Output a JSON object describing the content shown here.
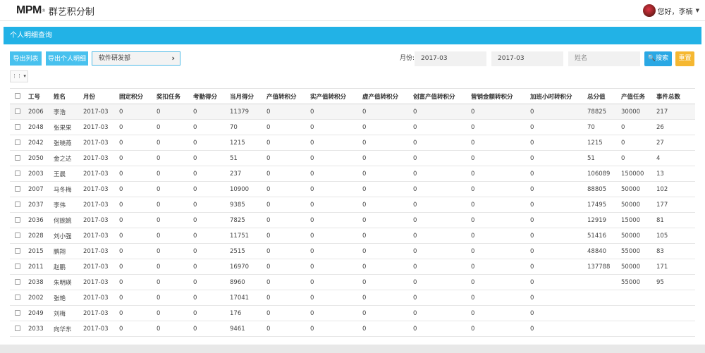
{
  "header": {
    "logo_mark": "MPM",
    "logo_sup": "®",
    "brand": "群艺积分制",
    "greeting": "您好，李楠",
    "caret": "▼"
  },
  "panel": {
    "title": "个人明细查询"
  },
  "toolbar": {
    "export_list": "导出列表",
    "export_detail": "导出个人明细",
    "department": "软件研发部",
    "chevron": "›",
    "month_label": "月份:",
    "month_from": "2017-03",
    "month_to": "2017-03",
    "name_placeholder": "姓名",
    "search": "🔍搜索",
    "reset": "重置",
    "columns_btn": "⋮⋮ ▾"
  },
  "table": {
    "headers": [
      "工号",
      "姓名",
      "月份",
      "固定积分",
      "奖扣任务",
      "考勤得分",
      "当月得分",
      "产值转积分",
      "实产值转积分",
      "虚产值转积分",
      "创富产值转积分",
      "营销金额转积分",
      "加班小时转积分",
      "总分值",
      "产值任务",
      "事件总数"
    ],
    "rows": [
      [
        "2006",
        "李浩",
        "2017-03",
        "0",
        "0",
        "0",
        "11379",
        "0",
        "0",
        "0",
        "0",
        "0",
        "0",
        "78825",
        "30000",
        "217"
      ],
      [
        "2048",
        "张果果",
        "2017-03",
        "0",
        "0",
        "0",
        "70",
        "0",
        "0",
        "0",
        "0",
        "0",
        "0",
        "70",
        "0",
        "26"
      ],
      [
        "2042",
        "张晓燕",
        "2017-03",
        "0",
        "0",
        "0",
        "1215",
        "0",
        "0",
        "0",
        "0",
        "0",
        "0",
        "1215",
        "0",
        "27"
      ],
      [
        "2050",
        "金之达",
        "2017-03",
        "0",
        "0",
        "0",
        "51",
        "0",
        "0",
        "0",
        "0",
        "0",
        "0",
        "51",
        "0",
        "4"
      ],
      [
        "2003",
        "王晨",
        "2017-03",
        "0",
        "0",
        "0",
        "237",
        "0",
        "0",
        "0",
        "0",
        "0",
        "0",
        "106089",
        "150000",
        "13"
      ],
      [
        "2007",
        "马冬梅",
        "2017-03",
        "0",
        "0",
        "0",
        "10900",
        "0",
        "0",
        "0",
        "0",
        "0",
        "0",
        "88805",
        "50000",
        "102"
      ],
      [
        "2037",
        "李伟",
        "2017-03",
        "0",
        "0",
        "0",
        "9385",
        "0",
        "0",
        "0",
        "0",
        "0",
        "0",
        "17495",
        "50000",
        "177"
      ],
      [
        "2036",
        "何婉婉",
        "2017-03",
        "0",
        "0",
        "0",
        "7825",
        "0",
        "0",
        "0",
        "0",
        "0",
        "0",
        "12919",
        "15000",
        "81"
      ],
      [
        "2028",
        "刘小强",
        "2017-03",
        "0",
        "0",
        "0",
        "11751",
        "0",
        "0",
        "0",
        "0",
        "0",
        "0",
        "51416",
        "50000",
        "105"
      ],
      [
        "2015",
        "鹏翔",
        "2017-03",
        "0",
        "0",
        "0",
        "2515",
        "0",
        "0",
        "0",
        "0",
        "0",
        "0",
        "48840",
        "55000",
        "83"
      ],
      [
        "2011",
        "赵鹏",
        "2017-03",
        "0",
        "0",
        "0",
        "16970",
        "0",
        "0",
        "0",
        "0",
        "0",
        "0",
        "137788",
        "50000",
        "171"
      ],
      [
        "2038",
        "朱明瑛",
        "2017-03",
        "0",
        "0",
        "0",
        "8960",
        "0",
        "0",
        "0",
        "0",
        "0",
        "0",
        "",
        "55000",
        "95"
      ],
      [
        "2002",
        "张艳",
        "2017-03",
        "0",
        "0",
        "0",
        "17041",
        "0",
        "0",
        "0",
        "0",
        "0",
        "0",
        "",
        "",
        ""
      ],
      [
        "2049",
        "刘梅",
        "2017-03",
        "0",
        "0",
        "0",
        "176",
        "0",
        "0",
        "0",
        "0",
        "0",
        "0",
        "",
        "",
        ""
      ],
      [
        "2033",
        "向华东",
        "2017-03",
        "0",
        "0",
        "0",
        "9461",
        "0",
        "0",
        "0",
        "0",
        "0",
        "0",
        "",
        "",
        ""
      ]
    ]
  }
}
